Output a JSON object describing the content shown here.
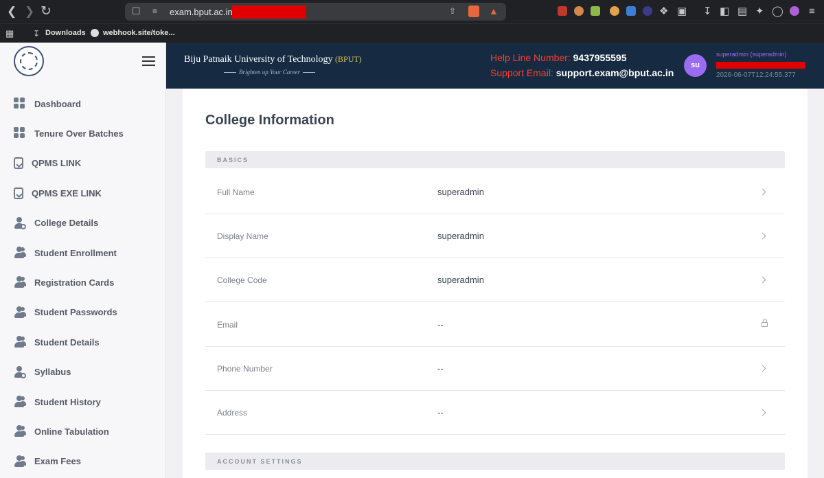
{
  "browser": {
    "url": "exam.bput.ac.in/",
    "bookmarks": [
      "Downloads",
      "webhook.site/toke..."
    ]
  },
  "sidebar": {
    "items": [
      {
        "label": "Dashboard",
        "icon": "grid-icon"
      },
      {
        "label": "Tenure Over Batches",
        "icon": "grid-icon"
      },
      {
        "label": "QPMS LINK",
        "icon": "document-download-icon"
      },
      {
        "label": "QPMS EXE LINK",
        "icon": "document-download-icon"
      },
      {
        "label": "College Details",
        "icon": "user-gear-icon"
      },
      {
        "label": "Student Enrollment",
        "icon": "users-icon"
      },
      {
        "label": "Registration Cards",
        "icon": "users-icon"
      },
      {
        "label": "Student Passwords",
        "icon": "users-icon"
      },
      {
        "label": "Student Details",
        "icon": "users-icon"
      },
      {
        "label": "Syllabus",
        "icon": "user-gear-icon"
      },
      {
        "label": "Student History",
        "icon": "users-icon"
      },
      {
        "label": "Online Tabulation",
        "icon": "users-icon"
      },
      {
        "label": "Exam Fees",
        "icon": "users-icon"
      }
    ]
  },
  "header": {
    "university": "Biju Patnaik University of Technology",
    "abbr": "(BPUT)",
    "tagline": "Brighten up Your Career",
    "helpline_label": "Help Line Number:",
    "helpline_value": "9437955595",
    "support_label": "Support Email:",
    "support_value": "support.exam@bput.ac.in",
    "avatar_initials": "su",
    "user_name": "superadmin (superadmin)",
    "timestamp": "2026-06-07T12:24:55.377"
  },
  "main": {
    "title": "College Information",
    "section_basics": "BASICS",
    "rows": [
      {
        "label": "Full Name",
        "value": "superadmin",
        "trailing": "chevron"
      },
      {
        "label": "Display Name",
        "value": "superadmin",
        "trailing": "chevron"
      },
      {
        "label": "College Code",
        "value": "superadmin",
        "trailing": "chevron"
      },
      {
        "label": "Email",
        "value": "--",
        "trailing": "lock"
      },
      {
        "label": "Phone Number",
        "value": "--",
        "trailing": "chevron"
      },
      {
        "label": "Address",
        "value": "--",
        "trailing": "chevron"
      }
    ],
    "section_account": "ACCOUNT SETTINGS"
  },
  "colors": {
    "header_bg": "#162b42",
    "accent_purple": "#9b6cf0",
    "help_red": "#ff3b30"
  }
}
